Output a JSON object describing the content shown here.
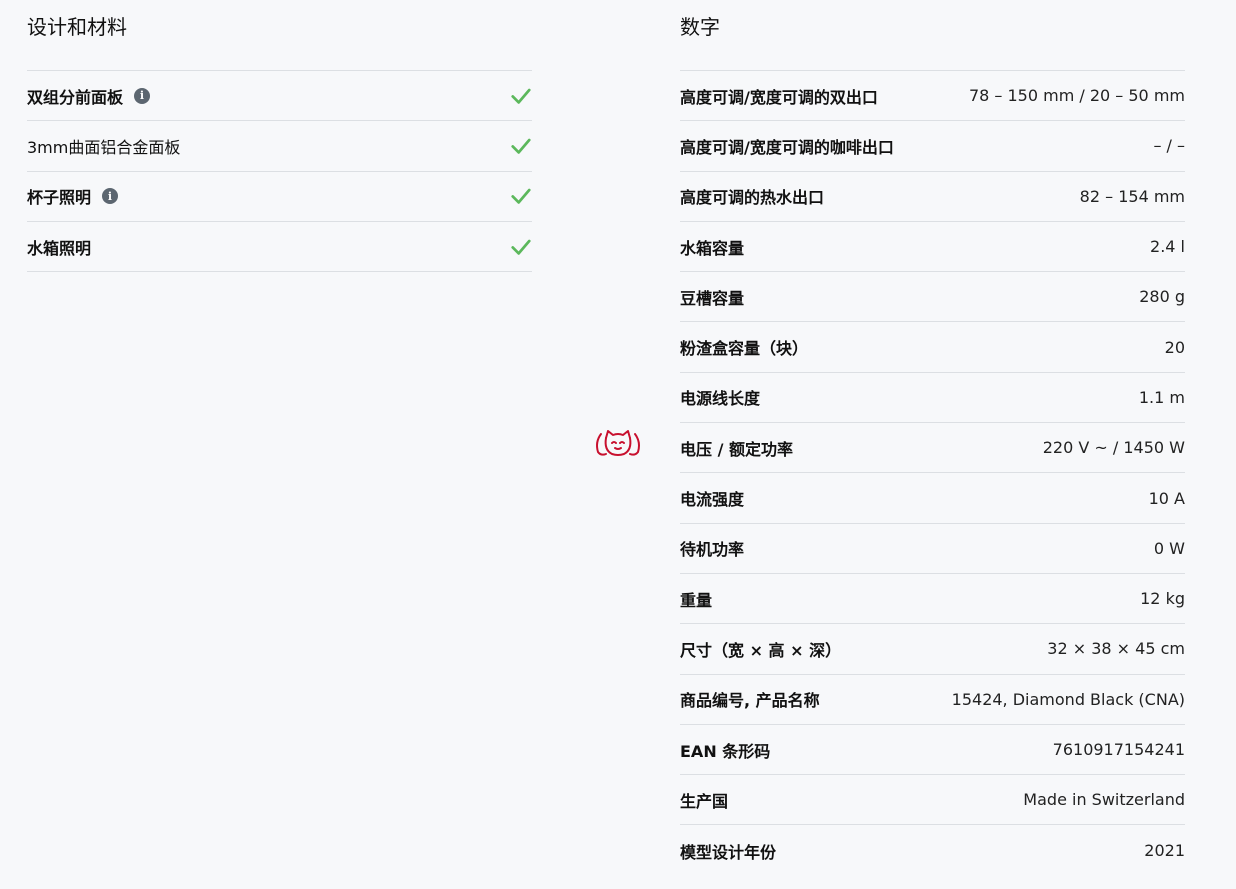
{
  "left": {
    "title": "设计和材料",
    "items": [
      {
        "label": "双组分前面板",
        "has_info": true,
        "check": true,
        "bold": true
      },
      {
        "label": "3mm曲面铝合金面板",
        "has_info": false,
        "check": true,
        "bold": false
      },
      {
        "label": "杯子照明",
        "has_info": true,
        "check": true,
        "bold": true
      },
      {
        "label": "水箱照明",
        "has_info": false,
        "check": true,
        "bold": true
      }
    ],
    "info_glyph": "i",
    "icons": {
      "info": "info-icon",
      "check": "check-icon"
    },
    "check_color": "#5cb85c"
  },
  "right": {
    "title": "数字",
    "rows": [
      {
        "label": "高度可调/宽度可调的双出口",
        "value": "78 – 150 mm / 20 – 50 mm"
      },
      {
        "label": "高度可调/宽度可调的咖啡出口",
        "value": "– / –"
      },
      {
        "label": "高度可调的热水出口",
        "value": "82 – 154 mm"
      },
      {
        "label": "水箱容量",
        "value": "2.4 l"
      },
      {
        "label": "豆槽容量",
        "value": "280 g"
      },
      {
        "label": "粉渣盒容量（块）",
        "value": "20"
      },
      {
        "label": "电源线长度",
        "value": "1.1 m"
      },
      {
        "label": "电压 / 额定功率",
        "value": "220 V ~ / 1450 W"
      },
      {
        "label": "电流强度",
        "value": "10 A"
      },
      {
        "label": "待机功率",
        "value": "0 W"
      },
      {
        "label": "重量",
        "value": "12 kg"
      },
      {
        "label": "尺寸（宽 × 高 × 深）",
        "value": "32 × 38 × 45 cm"
      },
      {
        "label": "商品编号, 产品名称",
        "value": "15424, Diamond Black (CNA)"
      },
      {
        "label": "EAN 条形码",
        "value": "7610917154241"
      },
      {
        "label": "生产国",
        "value": "Made in Switzerland"
      },
      {
        "label": "模型设计年份",
        "value": "2021"
      }
    ]
  },
  "mascot": {
    "icon": "cat-mascot-icon",
    "color": "#c8102e"
  }
}
